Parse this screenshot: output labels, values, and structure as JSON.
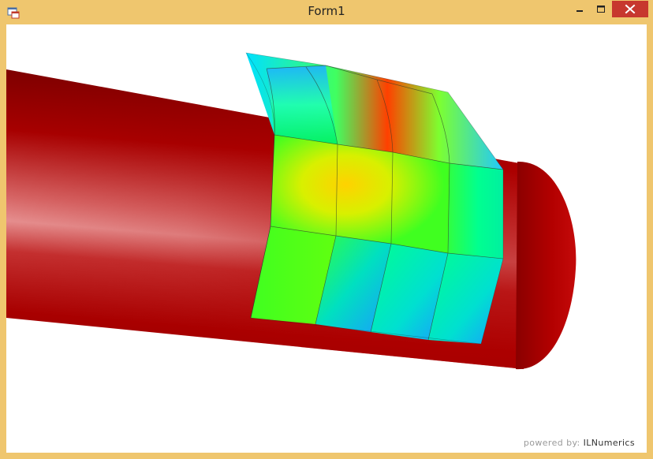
{
  "window": {
    "title": "Form1",
    "frame_color": "#EFC66E",
    "close_color": "#C7372E"
  },
  "titlebar_buttons": {
    "minimize": "minimize-icon",
    "maximize": "maximize-icon",
    "close": "close-icon"
  },
  "scene": {
    "background": "#FFFFFF",
    "cylinder_color": "#B00000",
    "surface_colormap": [
      "#1E90FF",
      "#00F0A0",
      "#40FF10",
      "#FFD000",
      "#E02000"
    ]
  },
  "footer": {
    "powered_label": "powered by:",
    "brand": "ILNumerics"
  }
}
